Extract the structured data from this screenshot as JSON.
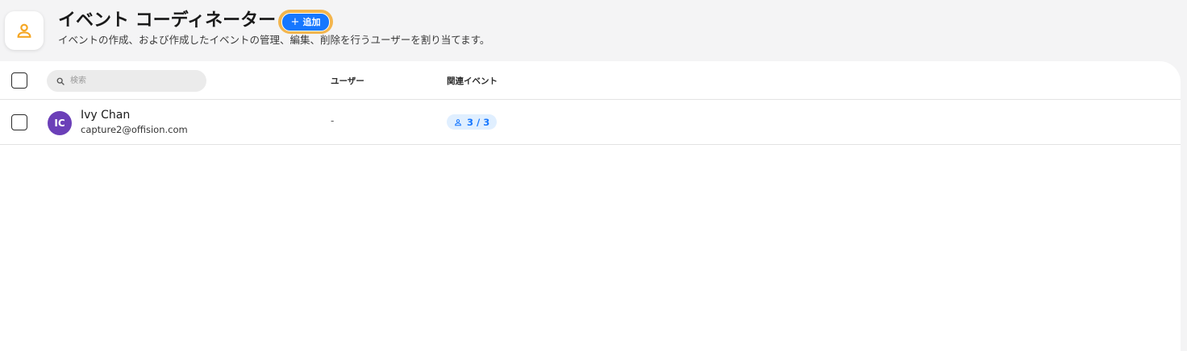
{
  "header": {
    "title": "イベント コーディネーター",
    "add_button_label": "追加",
    "add_button_icon": "plus-icon",
    "subtitle": "イベントの作成、および作成したイベントの管理、編集、削除を行うユーザーを割り当てます。",
    "app_icon": "person-icon",
    "app_icon_color": "#f5a623",
    "accent_color": "#1677ff"
  },
  "table": {
    "search": {
      "placeholder": "検索",
      "value": "",
      "icon": "search-icon"
    },
    "columns": [
      "ユーザー",
      "関連イベント"
    ],
    "rows": [
      {
        "avatar_initials": "IC",
        "avatar_color": "#6b3fb8",
        "name": "Ivy Chan",
        "email": "capture2@offision.com",
        "user": "-",
        "events_icon": "person-icon",
        "events": "3 / 3"
      }
    ]
  }
}
